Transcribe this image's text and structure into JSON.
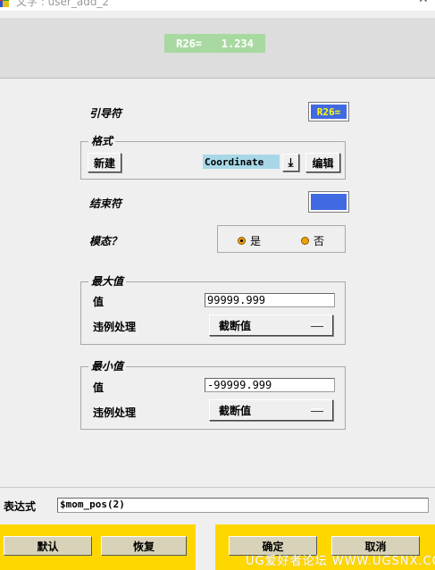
{
  "window": {
    "title": "文字 : user_add_2"
  },
  "preview": {
    "text": "R26=   1.234"
  },
  "prefix": {
    "label": "引导符",
    "value": "R26=",
    "color": "#4169e1"
  },
  "format": {
    "legend": "格式",
    "new_button": "新建",
    "selected": "Coordinate",
    "edit_button": "编辑"
  },
  "suffix": {
    "label": "结束符",
    "color": "#4169e1"
  },
  "modal": {
    "label": "模态？",
    "options": [
      "是",
      "否"
    ],
    "selected": "是"
  },
  "max": {
    "legend": "最大值",
    "value_label": "值",
    "value": "99999.999",
    "violation_label": "违例处理",
    "violation_value": "截断值"
  },
  "min": {
    "legend": "最小值",
    "value_label": "值",
    "value": "-99999.999",
    "violation_label": "违例处理",
    "violation_value": "截断值"
  },
  "expression": {
    "label": "表达式",
    "value": "$mom_pos(2)"
  },
  "buttons": {
    "default": "默认",
    "restore": "恢复",
    "ok": "确定",
    "cancel": "取消"
  },
  "watermark": "UG爱好者论坛 WWW.UGSNX.COM",
  "colors": {
    "panel_yellow": "#ffd700",
    "preview_green": "#a8d9a0",
    "combo_blue": "#a8d8e8"
  }
}
